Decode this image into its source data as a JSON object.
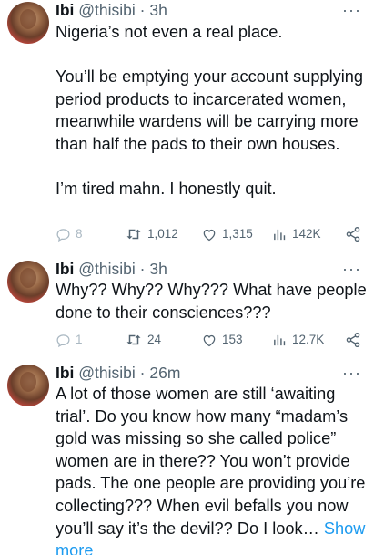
{
  "tweets": [
    {
      "name": "Ibi",
      "handle": "@thisibi",
      "sep": " · ",
      "time": "3h",
      "paragraphs": [
        "Nigeria’s not even a real place.",
        "You’ll be emptying your account supplying period products to incarcerated women, meanwhile wardens will be carrying more than half the pads to their own houses.",
        "I’m tired mahn. I honestly quit."
      ],
      "replies": "8",
      "retweets": "1,012",
      "likes": "1,315",
      "views": "142K"
    },
    {
      "name": "Ibi",
      "handle": "@thisibi",
      "sep": " · ",
      "time": "3h",
      "paragraphs": [
        "Why?? Why?? Why??? What have people done to their consciences???"
      ],
      "replies": "1",
      "retweets": "24",
      "likes": "153",
      "views": "12.7K"
    },
    {
      "name": "Ibi",
      "handle": "@thisibi",
      "sep": " · ",
      "time": "26m",
      "paragraphs": [
        "A lot of those women are still ‘awaiting trial’. Do you know how many “madam’s gold was missing so she called police” women are in there?? You won’t provide pads. The one people are providing you’re collecting??? When evil befalls you now you’ll say it’s the devil?? Do I look…"
      ],
      "show_more": "Show more"
    }
  ],
  "more_glyph": "···",
  "colors": {
    "text": "#0f1419",
    "secondary": "#536471",
    "link": "#1d9bf0"
  },
  "icons": [
    "reply-icon",
    "retweet-icon",
    "like-icon",
    "views-icon",
    "share-icon",
    "more-icon"
  ]
}
